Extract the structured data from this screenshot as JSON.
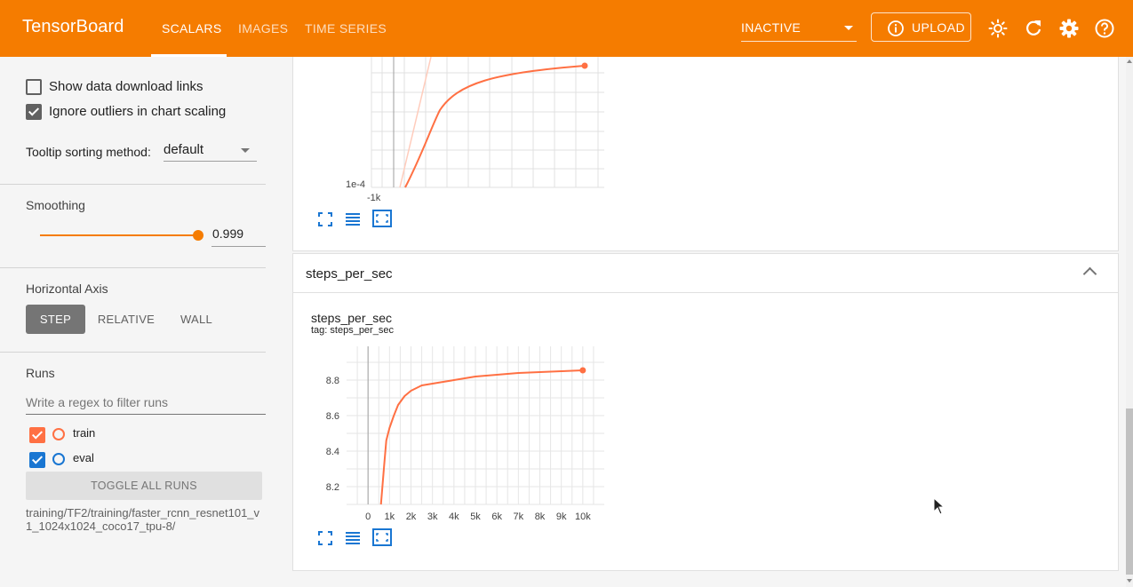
{
  "header": {
    "brand": "TensorBoard",
    "tabs": [
      {
        "label": "SCALARS",
        "active": true
      },
      {
        "label": "IMAGES",
        "active": false
      },
      {
        "label": "TIME SERIES",
        "active": false
      }
    ],
    "run_select": "INACTIVE",
    "upload_label": "UPLOAD",
    "icons": [
      "brightness-icon",
      "refresh-icon",
      "settings-icon",
      "help-icon"
    ],
    "accent_color": "#f57c00"
  },
  "sidebar": {
    "show_download_links": {
      "label": "Show data download links",
      "checked": false
    },
    "ignore_outliers": {
      "label": "Ignore outliers in chart scaling",
      "checked": true
    },
    "tooltip_sorting": {
      "label": "Tooltip sorting method:",
      "value": "default"
    },
    "smoothing": {
      "title": "Smoothing",
      "value": "0.999",
      "level": 0.999
    },
    "horizontal_axis": {
      "title": "Horizontal Axis",
      "options": [
        "STEP",
        "RELATIVE",
        "WALL"
      ],
      "selected": "STEP"
    },
    "runs": {
      "title": "Runs",
      "filter_placeholder": "Write a regex to filter runs",
      "items": [
        {
          "name": "train",
          "checked": true,
          "color": "#ff7043"
        },
        {
          "name": "eval",
          "checked": true,
          "color": "#1976d2"
        }
      ],
      "toggle_all_label": "TOGGLE ALL RUNS",
      "log_dir": "training/TF2/training/faster_rcnn_resnet101_v1_1024x1024_coco17_tpu-8/"
    }
  },
  "main": {
    "top_chart": {
      "y_tick": "1e-4",
      "x_tick": "-1k"
    },
    "group": {
      "title": "steps_per_sec"
    },
    "steps_chart": {
      "title": "steps_per_sec",
      "tag": "tag: steps_per_sec"
    }
  },
  "chart_data": [
    {
      "type": "line",
      "title": "steps_per_sec",
      "xlabel": "",
      "ylabel": "",
      "x_ticks": [
        "0",
        "1k",
        "2k",
        "3k",
        "4k",
        "5k",
        "6k",
        "7k",
        "8k",
        "9k",
        "10k"
      ],
      "y_ticks": [
        "8.2",
        "8.4",
        "8.6",
        "8.8"
      ],
      "xlim": [
        -1000,
        11000
      ],
      "ylim": [
        8.1,
        8.99
      ],
      "grid": true,
      "series": [
        {
          "name": "train",
          "color": "#ff7043",
          "smoothed": true,
          "x": [
            600,
            750,
            850,
            1000,
            1200,
            1400,
            1700,
            2000,
            2500,
            3000,
            3500,
            4000,
            4500,
            5000,
            6000,
            7000,
            8000,
            9000,
            10000
          ],
          "values": [
            8.1,
            8.32,
            8.46,
            8.53,
            8.6,
            8.66,
            8.71,
            8.74,
            8.77,
            8.78,
            8.79,
            8.8,
            8.81,
            8.82,
            8.83,
            8.84,
            8.845,
            8.85,
            8.855
          ]
        }
      ]
    }
  ]
}
